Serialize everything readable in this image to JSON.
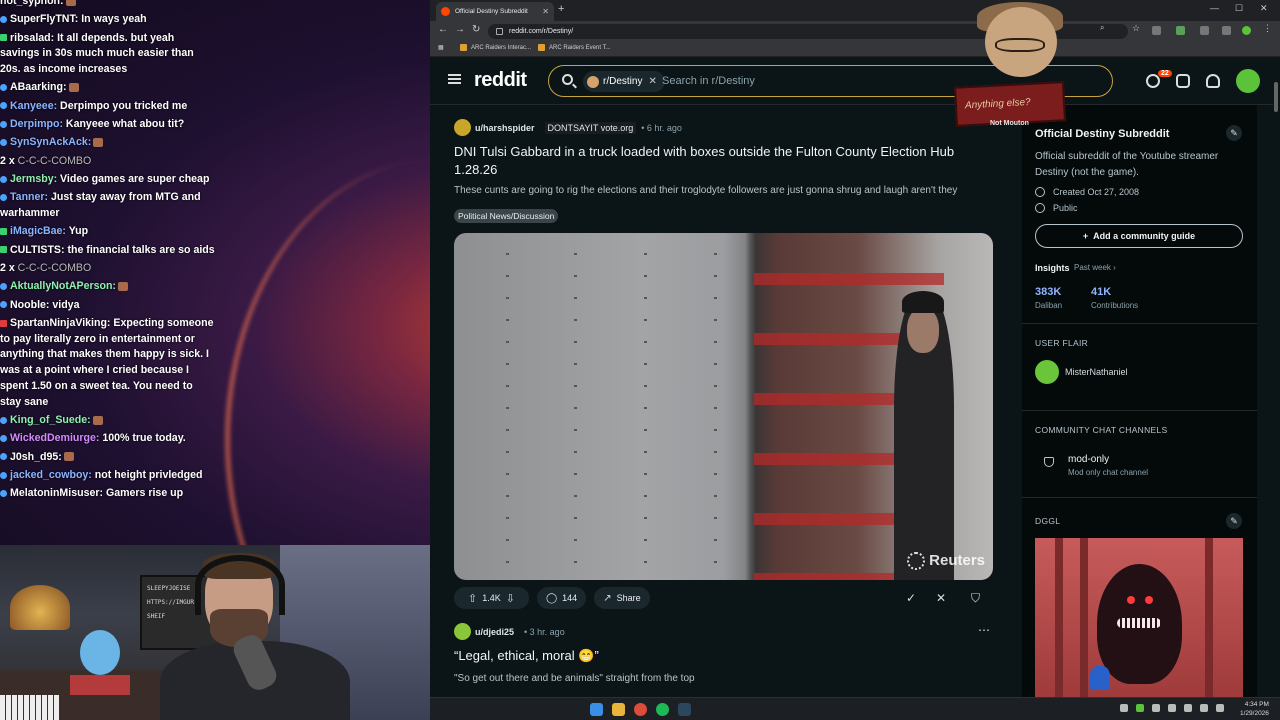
{
  "chat": {
    "lines": [
      {
        "user": "not_syphon:",
        "msg": "",
        "badge": "none",
        "user_color": "#ffffff"
      },
      {
        "user": "SuperFlyTNT:",
        "msg": " In ways yeah",
        "badge": "blue",
        "user_color": "#ffffff"
      },
      {
        "user": "ribsalad:",
        "msg": " It all depends. but yeah savings in 30s much much easier than 20s. as income increases",
        "badge": "green",
        "user_color": "#ffffff"
      },
      {
        "user": "ABaarking:",
        "msg": "",
        "badge": "blue",
        "user_color": "#ffffff"
      },
      {
        "user": "Kanyeee:",
        "msg": " Derpimpo you tricked me",
        "badge": "blue",
        "user_color": "#8ab4ff"
      },
      {
        "user": "Derpimpo:",
        "msg": " Kanyeee what abou tit?",
        "badge": "blue",
        "user_color": "#8ab4ff"
      },
      {
        "user": "SynSynAckAck:",
        "msg": "",
        "badge": "blue",
        "user_color": "#8ab4ff"
      },
      {
        "user": "2 x ",
        "msg": "C-C-C-COMBO",
        "badge": "none",
        "user_color": "#ffffff",
        "combo": true
      },
      {
        "user": "Jermsby:",
        "msg": " Video games are super cheap",
        "badge": "blue",
        "user_color": "#8ff0b0"
      },
      {
        "user": "Tanner:",
        "msg": " Just stay away from MTG and warhammer",
        "badge": "blue",
        "user_color": "#8ab4ff"
      },
      {
        "user": "iMagicBae:",
        "msg": " Yup",
        "badge": "green",
        "user_color": "#8ab4ff"
      },
      {
        "user": "CULTISTS:",
        "msg": " the financial talks are so aids",
        "badge": "green",
        "user_color": "#ffffff"
      },
      {
        "user": "2 x ",
        "msg": "C-C-C-COMBO",
        "badge": "none",
        "user_color": "#ffffff",
        "combo": true
      },
      {
        "user": "AktuallyNotAPerson:",
        "msg": "",
        "badge": "blue",
        "user_color": "#8ff0b0"
      },
      {
        "user": "Nooble:",
        "msg": " vidya",
        "badge": "blue",
        "user_color": "#ffffff"
      },
      {
        "user": "SpartanNinjaViking:",
        "msg": " Expecting someone to pay literally zero in entertainment or anything that makes them happy is sick. I was at a point where I cried because I spent 1.50 on a sweet tea. You need to stay sane",
        "badge": "red",
        "user_color": "#ffffff"
      },
      {
        "user": "King_of_Suede:",
        "msg": "",
        "badge": "blue",
        "user_color": "#8ff0b0"
      },
      {
        "user": "WickedDemiurge:",
        "msg": " 100% true today.",
        "badge": "blue",
        "user_color": "#d28cff"
      },
      {
        "user": "J0sh_d95:",
        "msg": "",
        "badge": "blue",
        "user_color": "#ffffff"
      },
      {
        "user": "jacked_cowboy:",
        "msg": " not height privledged",
        "badge": "blue",
        "user_color": "#8ab4ff"
      },
      {
        "user": "MelatoninMisuser:",
        "msg": " Gamers rise up",
        "badge": "blue",
        "user_color": "#ffffff"
      }
    ]
  },
  "webcam": {
    "board_lines": [
      "SLEEPYJOEISE",
      "HTTPS://IMGUR",
      "SHEIF"
    ]
  },
  "browser": {
    "tab_title": "Official Destiny Subreddit",
    "url": "reddit.com/r/Destiny/",
    "bookmarks": [
      "ARC Raiders Interac...",
      "ARC Raiders Event T..."
    ]
  },
  "reddit": {
    "logo": "reddit",
    "search_chip": "r/Destiny",
    "search_placeholder": "Search in r/Destiny",
    "notif_count": "22",
    "post1": {
      "user": "u/harshspider",
      "flair": "DONTSAYIT vote.org",
      "time": "• 6 hr. ago",
      "title": "DNI Tulsi Gabbard in a truck loaded with boxes outside the Fulton County Election Hub 1.28.26",
      "body": "These cunts are going to rig the elections and their troglodyte followers are just gonna shrug and laugh aren't they",
      "tag": "Political News/Discussion",
      "watermark": "Reuters",
      "votes": "1.4K",
      "comments": "144",
      "share": "Share"
    },
    "post2": {
      "user": "u/djedi25",
      "time": "• 3 hr. ago",
      "title": "“Legal, ethical, moral 😁”",
      "body": "\"So get out there and be animals\" straight from the top"
    },
    "sidebar": {
      "title": "Official Destiny Subreddit",
      "desc": "Official subreddit of the Youtube streamer Destiny (not the game).",
      "created": "Created Oct 27, 2008",
      "privacy": "Public",
      "guide_btn": "Add a community guide",
      "insights": "Insights",
      "past_week": "Past week",
      "stat1_val": "383K",
      "stat1_label": "Daliban",
      "stat2_val": "41K",
      "stat2_label": "Contributions",
      "user_flair_head": "USER FLAIR",
      "user_flair": "MisterNathaniel",
      "chat_head": "COMMUNITY CHAT CHANNELS",
      "channel_name": "mod-only",
      "channel_desc": "Mod only chat channel",
      "dggl": "DGGL"
    },
    "overlay_sign": "Anything else?",
    "overlay_note": "Not Mouton"
  },
  "taskbar": {
    "time": "4:34 PM",
    "date": "1/29/2026"
  }
}
